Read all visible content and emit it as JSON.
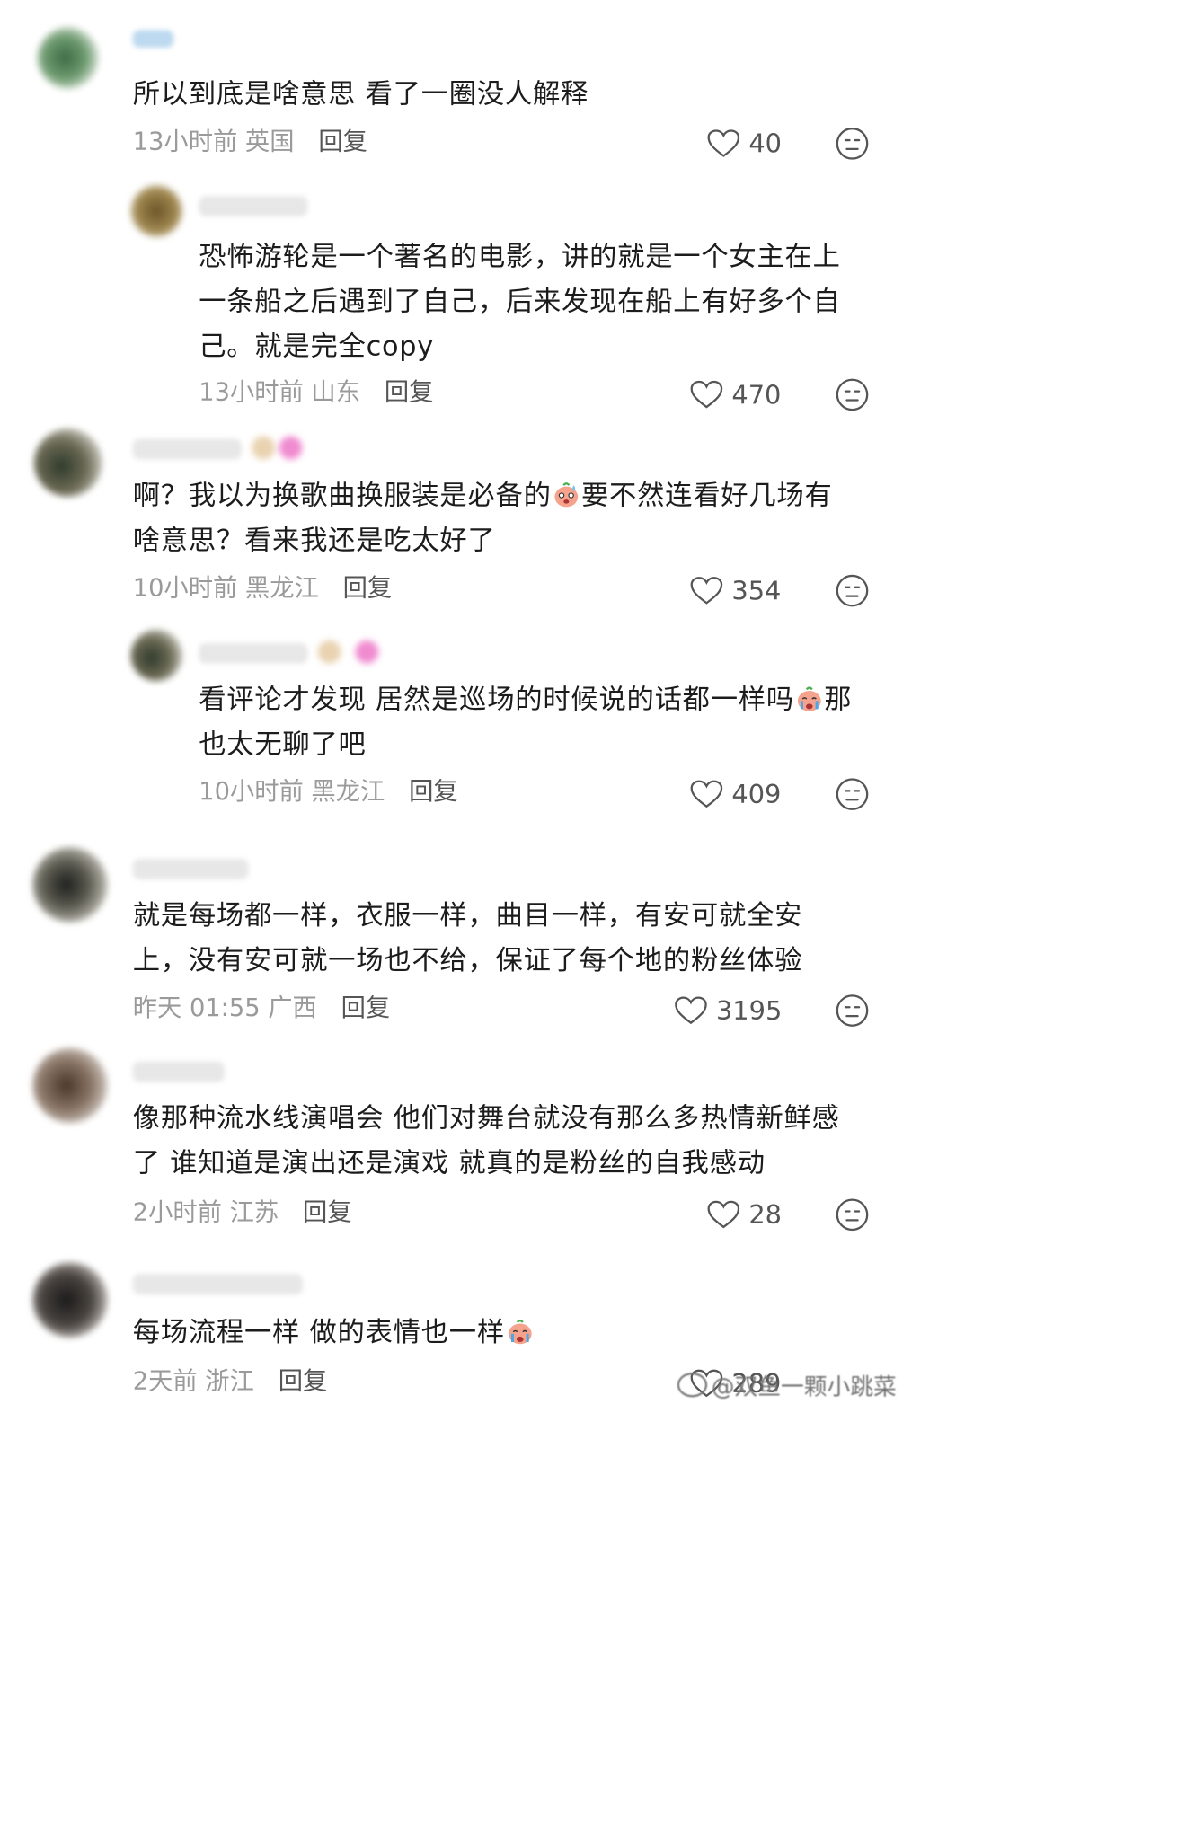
{
  "comments": [
    {
      "text_lines": [
        "所以到底是啥意思 看了一圈没人解释"
      ],
      "time": "13小时前",
      "location": "英国",
      "reply_label": "回复",
      "likes": "40"
    },
    {
      "text_lines": [
        "恐怖游轮是一个著名的电影，讲的就是一个女主在上",
        "一条船之后遇到了自己，后来发现在船上有好多个自",
        "己。就是完全copy"
      ],
      "time": "13小时前",
      "location": "山东",
      "reply_label": "回复",
      "likes": "470"
    },
    {
      "text_lines": [
        "啊？我以为换歌曲换服装是必备的",
        "要不然连看好几场有",
        "啥意思？看来我还是吃太好了"
      ],
      "time": "10小时前",
      "location": "黑龙江",
      "reply_label": "回复",
      "likes": "354"
    },
    {
      "text_lines": [
        "看评论才发现 居然是巡场的时候说的话都一样吗",
        "那",
        "也太无聊了吧"
      ],
      "time": "10小时前",
      "location": "黑龙江",
      "reply_label": "回复",
      "likes": "409"
    },
    {
      "text_lines": [
        "就是每场都一样，衣服一样，曲目一样，有安可就全安",
        "上，没有安可就一场也不给，保证了每个地的粉丝体验"
      ],
      "time": "昨天 01:55",
      "location": "广西",
      "reply_label": "回复",
      "likes": "3195"
    },
    {
      "text_lines": [
        "像那种流水线演唱会 他们对舞台就没有那么多热情新鲜感",
        "了 谁知道是演出还是演戏 就真的是粉丝的自我感动"
      ],
      "time": "2小时前",
      "location": "江苏",
      "reply_label": "回复",
      "likes": "28"
    },
    {
      "text_lines": [
        "每场流程一样 做的表情也一样"
      ],
      "time": "2天前",
      "location": "浙江",
      "reply_label": "回复",
      "likes": "289"
    }
  ],
  "watermark": "@双鱼一颗小跳菜",
  "icons": {
    "like": "heart-outline-icon",
    "reaction": "neutral-face-icon",
    "inline_emoji_sweat": "sweating-face-emoji",
    "inline_emoji_cry": "crying-face-emoji"
  },
  "colors": {
    "text": "#1c1c1c",
    "meta": "#9a9a9a",
    "icon": "#555555",
    "emoji": "#f6a38e"
  }
}
